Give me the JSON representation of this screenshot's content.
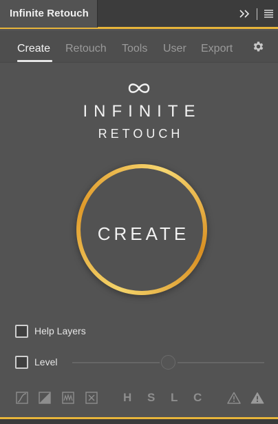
{
  "panel": {
    "title": "Infinite Retouch",
    "accent_color": "#e8b53a"
  },
  "nav": {
    "items": [
      {
        "label": "Create",
        "active": true
      },
      {
        "label": "Retouch",
        "active": false
      },
      {
        "label": "Tools",
        "active": false
      },
      {
        "label": "User",
        "active": false
      },
      {
        "label": "Export",
        "active": false
      }
    ],
    "settings_icon": "gear-icon"
  },
  "brand": {
    "logo_icon": "infinity-icon",
    "line1": "INFINITE",
    "line2": "RETOUCH"
  },
  "create_button": {
    "label": "CREATE"
  },
  "options": {
    "help_layers": {
      "label": "Help Layers",
      "checked": false
    },
    "level": {
      "label": "Level",
      "checked": false,
      "slider_value": 0.5
    }
  },
  "toolbar": {
    "icons": [
      "curves-icon",
      "contrast-icon",
      "waveform-icon",
      "close-box-icon"
    ],
    "hslc": [
      "H",
      "S",
      "L",
      "C"
    ],
    "warning_icons": [
      "warning-outline-icon",
      "warning-filled-icon"
    ]
  }
}
